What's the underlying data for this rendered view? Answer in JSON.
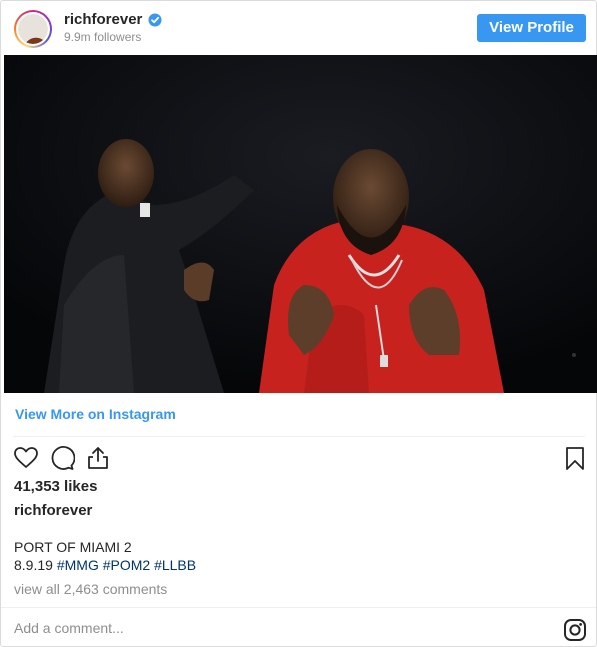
{
  "header": {
    "username": "richforever",
    "followers": "9.9m followers",
    "view_profile_label": "View Profile"
  },
  "post": {
    "view_more_label": "View More on Instagram",
    "likes": "41,353 likes",
    "caption_user": "richforever",
    "caption_title": "PORT OF MIAMI 2",
    "caption_date": "8.9.19",
    "hashtags": [
      "#MMG",
      "#POM2",
      "#LLBB"
    ],
    "view_comments": "view all 2,463 comments"
  },
  "comment": {
    "placeholder": "Add a comment..."
  },
  "colors": {
    "accent": "#3897f0",
    "hashtag": "#003569",
    "muted": "#8e8e8e",
    "verified": "#3897f0"
  },
  "icons": {
    "like": "heart-icon",
    "comment": "comment-icon",
    "share": "share-icon",
    "save": "bookmark-icon",
    "brand": "instagram-icon",
    "verified": "verified-badge-icon"
  }
}
